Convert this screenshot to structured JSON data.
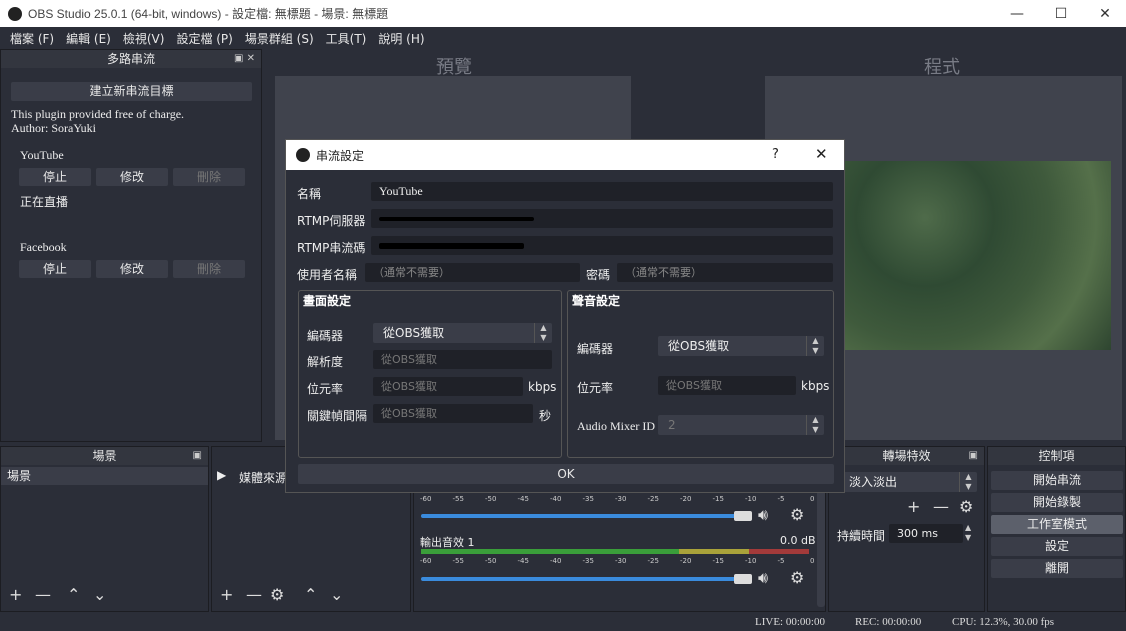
{
  "window": {
    "title": "OBS Studio 25.0.1 (64-bit, windows) - 設定檔: 無標題 - 場景: 無標題",
    "minimize": "—",
    "maximize": "☐",
    "close": "✕"
  },
  "menu": [
    "檔案 (F)",
    "編輯 (E)",
    "檢視(V)",
    "設定檔 (P)",
    "場景群組 (S)",
    "工具(T)",
    "說明 (H)"
  ],
  "multistream": {
    "title": "多路串流",
    "new_target": "建立新串流目標",
    "info1": "This plugin provided free of charge.",
    "info2": "Author: SoraYuki",
    "targets": [
      {
        "name": "YouTube",
        "stop": "停止",
        "edit": "修改",
        "delete": "刪除",
        "status": "正在直播"
      },
      {
        "name": "Facebook",
        "stop": "停止",
        "edit": "修改",
        "delete": "刪除"
      }
    ]
  },
  "preview_label": "預覽",
  "program_label": "程式",
  "dialog": {
    "title": "串流設定",
    "help": "?",
    "close": "✕",
    "name_label": "名稱",
    "name_value": "YouTube",
    "rtmp_server_label": "RTMP伺服器",
    "rtmp_key_label": "RTMP串流碼",
    "user_label": "使用者名稱",
    "user_placeholder": "（通常不需要）",
    "password_label": "密碼",
    "password_placeholder": "（通常不需要）",
    "video": {
      "title": "畫面設定",
      "encoder_label": "編碼器",
      "encoder_value": "從OBS獲取",
      "resolution_label": "解析度",
      "resolution_value": "從OBS獲取",
      "bitrate_label": "位元率",
      "bitrate_value": "從OBS獲取",
      "bitrate_unit": "kbps",
      "keyframe_label": "關鍵幀間隔",
      "keyframe_value": "從OBS獲取",
      "keyframe_unit": "秒"
    },
    "audio": {
      "title": "聲音設定",
      "encoder_label": "編碼器",
      "encoder_value": "從OBS獲取",
      "bitrate_label": "位元率",
      "bitrate_value": "從OBS獲取",
      "bitrate_unit": "kbps",
      "mixer_label": "Audio Mixer ID",
      "mixer_value": "2"
    },
    "ok": "OK"
  },
  "scenes": {
    "title": "場景",
    "item": "場景"
  },
  "sources": {
    "item": "媒體來源"
  },
  "mixer": {
    "ticks": [
      "-60",
      "-55",
      "-50",
      "-45",
      "-40",
      "-35",
      "-30",
      "-25",
      "-20",
      "-15",
      "-10",
      "-5",
      "0"
    ],
    "track2_name": "輸出音效 1",
    "track2_db": "0.0 dB"
  },
  "transitions": {
    "title": "轉場特效",
    "value": "淡入淡出",
    "duration_label": "持續時間",
    "duration_value": "300 ms"
  },
  "controls": {
    "title": "控制項",
    "start_stream": "開始串流",
    "start_record": "開始錄製",
    "studio_mode": "工作室模式",
    "settings": "設定",
    "exit": "離開"
  },
  "status": {
    "live": "LIVE: 00:00:00",
    "rec": "REC: 00:00:00",
    "cpu": "CPU: 12.3%, 30.00 fps"
  },
  "colors": {
    "bg": "#2b2e38",
    "accent": "#3a8bdd"
  }
}
